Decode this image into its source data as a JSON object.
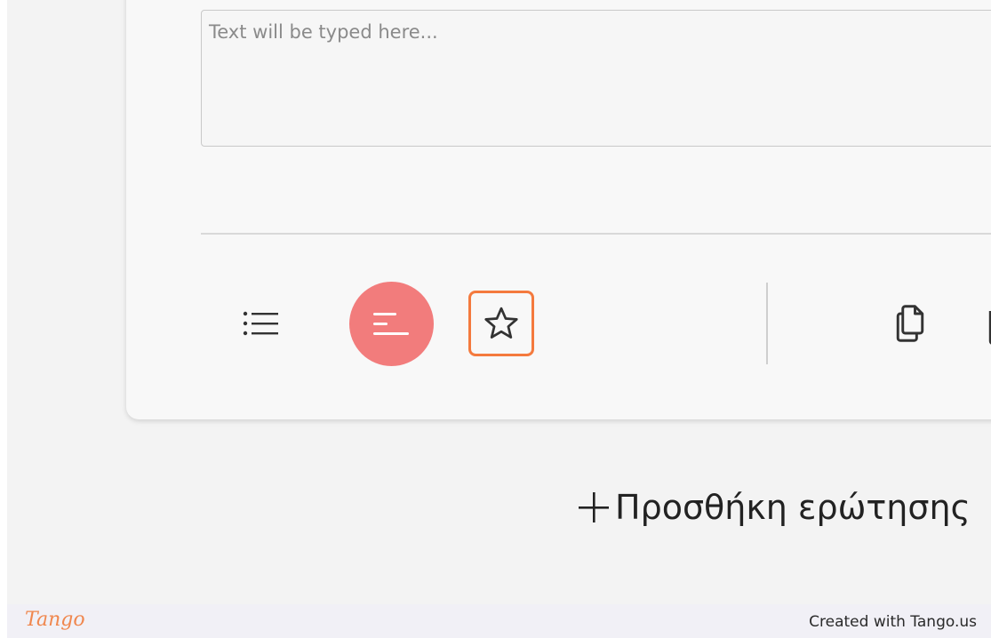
{
  "question_editor": {
    "answer_placeholder": "Text will be typed here..."
  },
  "toolbar": {
    "buttons": [
      {
        "name": "list-icon",
        "active": false
      },
      {
        "name": "short-text-icon",
        "active": true
      },
      {
        "name": "star-icon",
        "active": false,
        "highlighted": true
      },
      {
        "name": "copy-icon",
        "active": false
      },
      {
        "name": "trash-icon",
        "active": false
      }
    ]
  },
  "add_question": {
    "label": "Προσθήκη ερώτησης",
    "icon": "plus-icon"
  },
  "footer": {
    "brand": "Tango",
    "credit": "Created with Tango.us"
  },
  "colors": {
    "accent": "#f27c7c",
    "highlight": "#f47a3e",
    "brand": "#f0874e"
  }
}
